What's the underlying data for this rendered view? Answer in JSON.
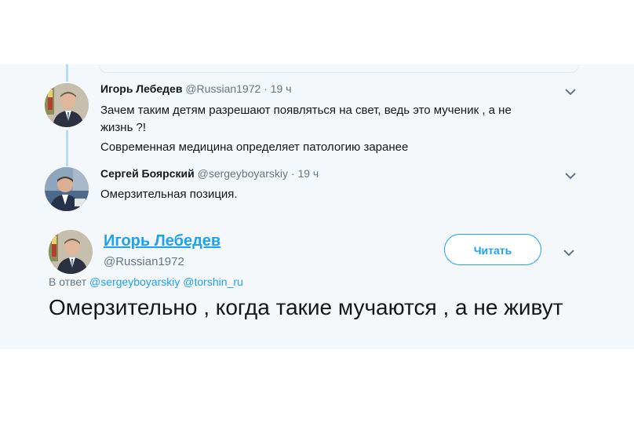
{
  "thread": [
    {
      "name": "Игорь Лебедев",
      "handle": "@Russian1972",
      "separator": "·",
      "time": "19 ч",
      "lines": [
        "Зачем таким детям разрешают появляться на свет, ведь это мученик , а не",
        "жизнь ?!",
        "Современная медицина определяет патологию заранее"
      ],
      "avatar_icon": "person-avatar-icon"
    },
    {
      "name": "Сергей Боярский",
      "handle": "@sergeyboyarskiy",
      "separator": "·",
      "time": "19 ч",
      "lines": [
        "Омерзительная позиция."
      ],
      "avatar_icon": "person-avatar-icon"
    }
  ],
  "main_tweet": {
    "name": "Игорь Лебедев",
    "handle": "@Russian1972",
    "follow_label": "Читать",
    "reply_prefix": "В ответ",
    "mentions": [
      "@sergeyboyarskiy",
      "@torshin_ru"
    ],
    "text": "Омерзительно , когда такие мучаются , а не живут"
  },
  "icons": {
    "menu": "chevron-down-icon"
  },
  "colors": {
    "accent": "#1da1f2",
    "thread_line": "#b6dcf5",
    "background": "#f5f8fa",
    "muted_text": "#657786",
    "text": "#14171a"
  }
}
